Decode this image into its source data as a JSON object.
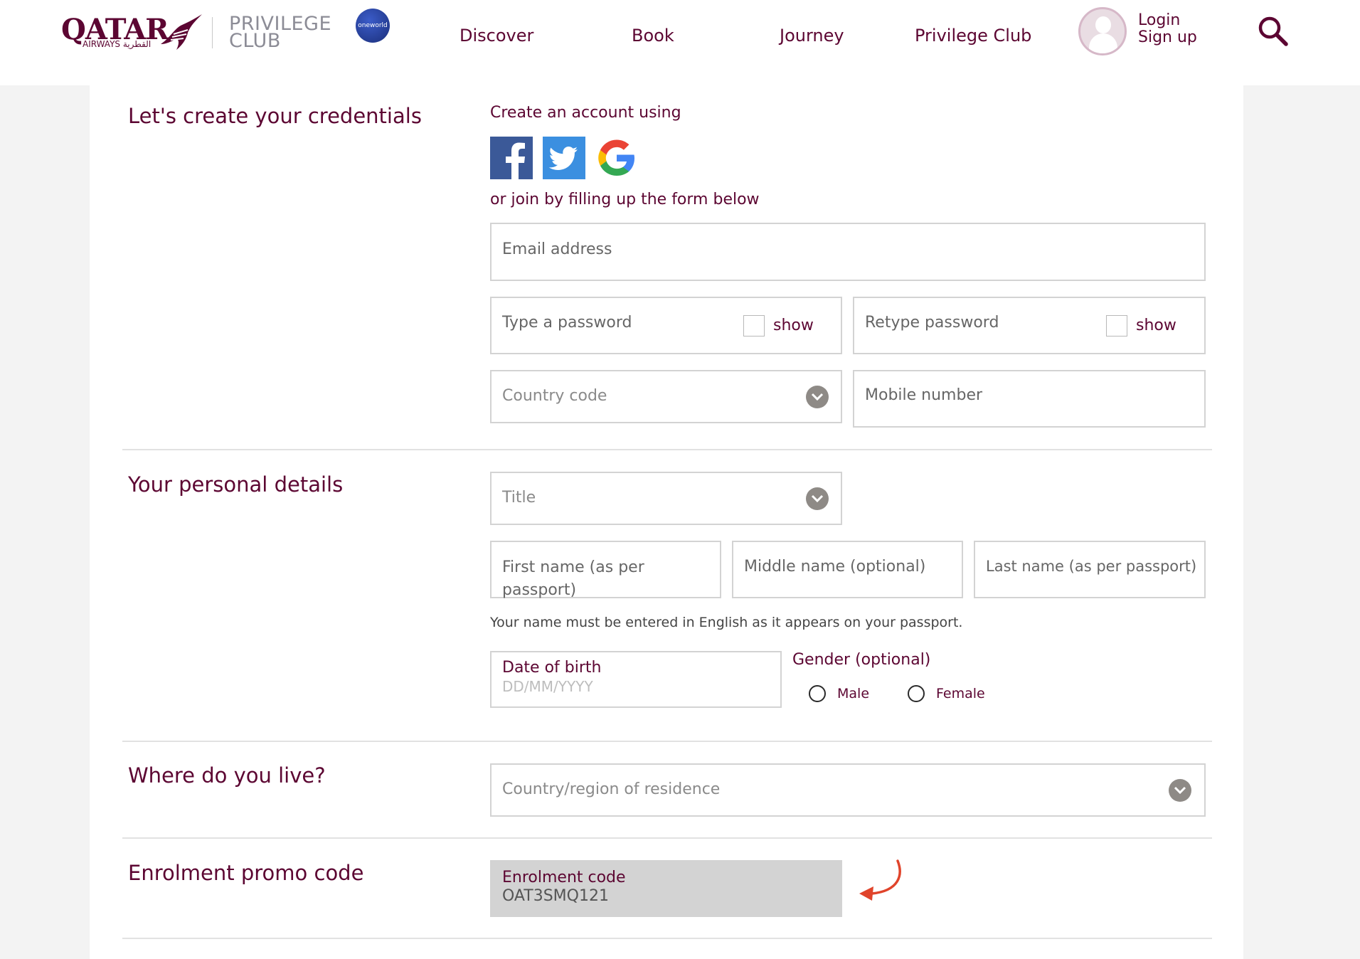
{
  "header": {
    "logo_text": "QATAR",
    "logo_sub": "AIRWAYS القطرية",
    "brand_line1": "PRIVILEGE",
    "brand_line2": "CLUB",
    "oneworld_label": "oneworld",
    "nav": [
      {
        "label": "Discover"
      },
      {
        "label": "Book"
      },
      {
        "label": "Journey"
      },
      {
        "label": "Privilege Club"
      }
    ],
    "login_label": "Login",
    "signup_label": "Sign up",
    "search_icon": "search-icon"
  },
  "credentials": {
    "title": "Let's create your credentials",
    "create_account_text": "Create an account using",
    "social": [
      "facebook-icon",
      "twitter-icon",
      "google-icon"
    ],
    "or_join_text": "or join by filling up the form below",
    "email_placeholder": "Email address",
    "password_placeholder": "Type a password",
    "retype_placeholder": "Retype password",
    "show_label": "show",
    "country_code_placeholder": "Country code",
    "mobile_placeholder": "Mobile number"
  },
  "personal": {
    "title": "Your personal details",
    "title_placeholder": "Title",
    "first_name_placeholder": "First name (as per passport)",
    "middle_name_placeholder": "Middle name (optional)",
    "last_name_placeholder": "Last name (as per passport)",
    "name_hint": "Your name must be entered in English as it appears on your passport.",
    "dob_label": "Date of birth",
    "dob_placeholder": "DD/MM/YYYY",
    "gender_label": "Gender (optional)",
    "male_label": "Male",
    "female_label": "Female"
  },
  "residence": {
    "title": "Where do you live?",
    "country_placeholder": "Country/region of residence"
  },
  "promo": {
    "title": "Enrolment promo code",
    "code_label": "Enrolment code",
    "code_value": "OAT3SMQ121",
    "arrow_color": "#e0442b"
  },
  "colors": {
    "brand": "#5c0632",
    "background": "#f3f3f3",
    "chevron": "#8e8a86"
  }
}
